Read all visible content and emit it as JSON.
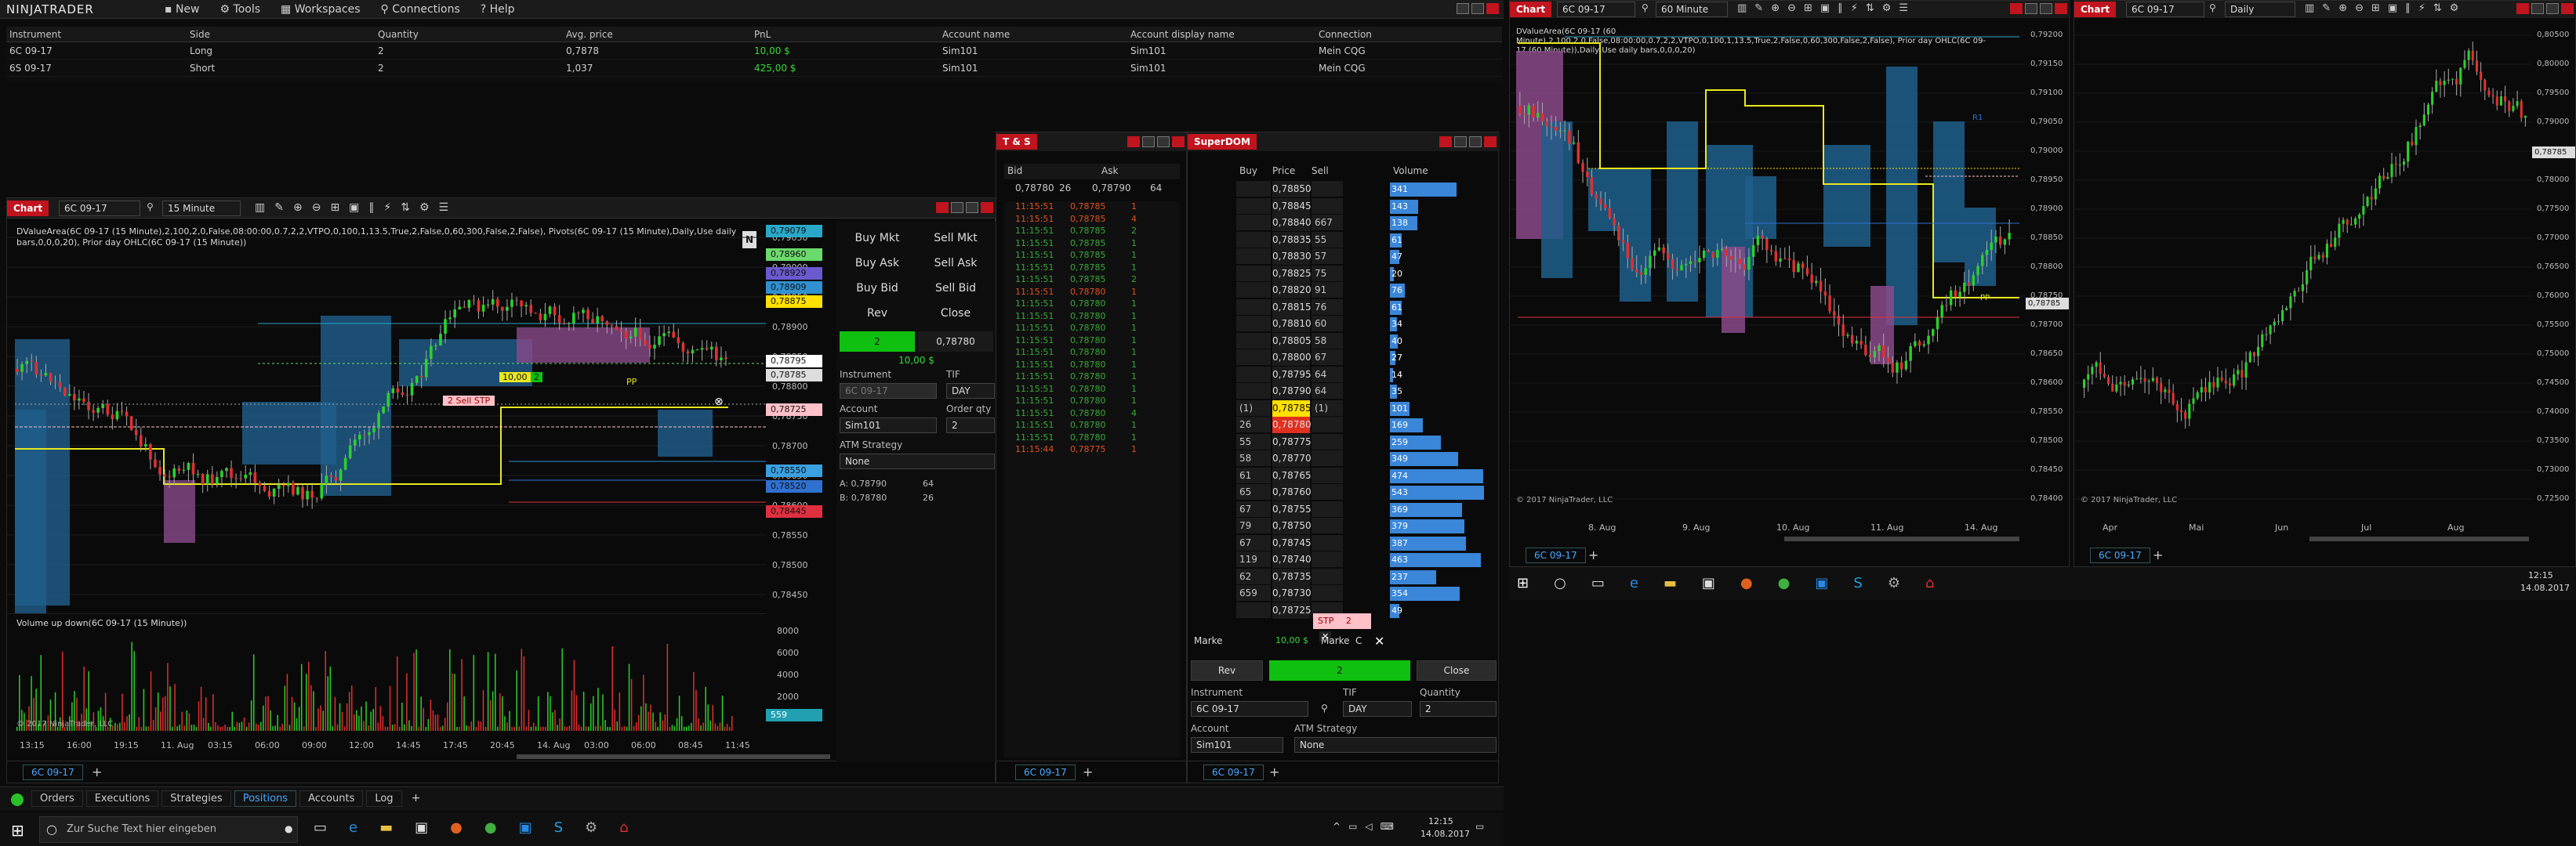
{
  "topbar": {
    "logo": "NINJATRADER",
    "menu": [
      "New",
      "Tools",
      "Workspaces",
      "Connections",
      "Help"
    ]
  },
  "positions": {
    "headers": [
      "Instrument",
      "Side",
      "Quantity",
      "Avg. price",
      "PnL",
      "Account name",
      "Account display name",
      "Connection"
    ],
    "rows": [
      [
        "6C 09-17",
        "Long",
        "2",
        "0,7878",
        "10,00 $",
        "Sim101",
        "Sim101",
        "Mein CQG"
      ],
      [
        "6S 09-17",
        "Short",
        "2",
        "1,037",
        "425,00 $",
        "Sim101",
        "Sim101",
        "Mein CQG"
      ]
    ]
  },
  "chart1": {
    "tab": "Chart",
    "instrument": "6C 09-17",
    "interval": "15 Minute",
    "info": "DValueArea(6C 09-17 (15 Minute),2,100,2,0,False,08:00:00,0.7,2,2,VTPO,0,100,1,13.5,True,2,False,0,60,300,False,2,False), Pivots(6C 09-17 (15 Minute),Daily,Use daily bars,0,0,0,20), Prior day OHLC(6C 09-17 (15 Minute))",
    "vol_label": "Volume up down(6C 09-17 (15 Minute))",
    "copyright": "© 2017 NinjaTrader, LLC",
    "price_ticks": [
      "0,79050",
      "0,79000",
      "0,78950",
      "0,78900",
      "0,78850",
      "0,78800",
      "0,78750",
      "0,78700",
      "0,78650",
      "0,78600",
      "0,78550",
      "0,78500",
      "0,78450"
    ],
    "price_flags": [
      {
        "t": "0,79079",
        "c": "#2aa8c8"
      },
      {
        "t": "0,78960",
        "c": "#6bd96b"
      },
      {
        "t": "0,78929",
        "c": "#6a5acd"
      },
      {
        "t": "0,78909",
        "c": "#3090d0"
      },
      {
        "t": "0,78875",
        "c": "#ffe000"
      },
      {
        "t": "0,78795",
        "c": "#ffffff"
      },
      {
        "t": "0,78785",
        "c": "#dddddd"
      },
      {
        "t": "0,78725",
        "c": "#ffc0c8"
      },
      {
        "t": "0,78550",
        "c": "#3aa0e0"
      },
      {
        "t": "0,78520",
        "c": "#3070d0"
      },
      {
        "t": "0,78445",
        "c": "#e03040"
      }
    ],
    "vol_ticks": [
      "8000",
      "6000",
      "4000",
      "2000"
    ],
    "vol_flag": "559",
    "time_ticks": [
      "13:15",
      "16:00",
      "19:15",
      "11. Aug",
      "03:15",
      "06:00",
      "09:00",
      "12:00",
      "14:45",
      "17:45",
      "20:45",
      "14. Aug",
      "03:00",
      "06:00",
      "08:45",
      "11:45"
    ],
    "pos_label": "10,00 $",
    "pos_qty": "2",
    "stop_label": "2 Sell STP",
    "pp_label": "PP",
    "bottom_tab": "6C 09-17"
  },
  "chart_trader": {
    "buttons": [
      "Buy Mkt",
      "Sell Mkt",
      "Buy Ask",
      "Sell Ask",
      "Buy Bid",
      "Sell Bid",
      "Rev",
      "Close"
    ],
    "qty": "2",
    "price": "0,78780",
    "pnl": "10,00 $",
    "instrument_label": "Instrument",
    "instrument": "6C 09-17",
    "tif_label": "TIF",
    "tif": "DAY",
    "account_label": "Account",
    "order_qty_label": "Order qty",
    "account": "Sim101",
    "order_qty": "2",
    "atm_label": "ATM Strategy",
    "atm": "None",
    "ask_line": "A:  0,78790",
    "ask_size": "64",
    "bid_line": "B:  0,78780",
    "bid_size": "26"
  },
  "ts": {
    "title": "T & S",
    "headers": [
      "Bid",
      "Ask"
    ],
    "bid": "0,78780",
    "bid_size": "26",
    "ask": "0,78790",
    "ask_size": "64",
    "rows": [
      [
        "11:15:51",
        "0,78785",
        "1",
        "r"
      ],
      [
        "11:15:51",
        "0,78785",
        "4",
        "r"
      ],
      [
        "11:15:51",
        "0,78785",
        "2",
        "g"
      ],
      [
        "11:15:51",
        "0,78785",
        "1",
        "g"
      ],
      [
        "11:15:51",
        "0,78785",
        "1",
        "g"
      ],
      [
        "11:15:51",
        "0,78785",
        "1",
        "g"
      ],
      [
        "11:15:51",
        "0,78785",
        "2",
        "g"
      ],
      [
        "11:15:51",
        "0,78780",
        "1",
        "r"
      ],
      [
        "11:15:51",
        "0,78780",
        "1",
        "g"
      ],
      [
        "11:15:51",
        "0,78780",
        "1",
        "g"
      ],
      [
        "11:15:51",
        "0,78780",
        "1",
        "g"
      ],
      [
        "11:15:51",
        "0,78780",
        "1",
        "g"
      ],
      [
        "11:15:51",
        "0,78780",
        "1",
        "g"
      ],
      [
        "11:15:51",
        "0,78780",
        "1",
        "g"
      ],
      [
        "11:15:51",
        "0,78780",
        "1",
        "g"
      ],
      [
        "11:15:51",
        "0,78780",
        "1",
        "g"
      ],
      [
        "11:15:51",
        "0,78780",
        "1",
        "g"
      ],
      [
        "11:15:51",
        "0,78780",
        "4",
        "g"
      ],
      [
        "11:15:51",
        "0,78780",
        "1",
        "g"
      ],
      [
        "11:15:51",
        "0,78780",
        "1",
        "g"
      ],
      [
        "11:15:44",
        "0,78775",
        "1",
        "r"
      ]
    ],
    "tab": "6C 09-17"
  },
  "dom": {
    "title": "SuperDOM",
    "headers": [
      "Buy",
      "Price",
      "Sell",
      "Volume"
    ],
    "rows": [
      [
        "",
        "0,78850",
        "",
        "341"
      ],
      [
        "",
        "0,78845",
        "",
        "143"
      ],
      [
        "",
        "0,78840",
        "667",
        "138"
      ],
      [
        "",
        "0,78835",
        "55",
        "61"
      ],
      [
        "",
        "0,78830",
        "57",
        "47"
      ],
      [
        "",
        "0,78825",
        "75",
        "20"
      ],
      [
        "",
        "0,78820",
        "91",
        "76"
      ],
      [
        "",
        "0,78815",
        "76",
        "61"
      ],
      [
        "",
        "0,78810",
        "60",
        "34"
      ],
      [
        "",
        "0,78805",
        "58",
        "40"
      ],
      [
        "",
        "0,78800",
        "67",
        "27"
      ],
      [
        "",
        "0,78795",
        "64",
        "14"
      ],
      [
        "",
        "0,78790",
        "64",
        "35"
      ],
      [
        "(1)",
        "0,78785",
        "(1)",
        "101"
      ],
      [
        "26",
        "0,78780",
        "",
        "169"
      ],
      [
        "55",
        "0,78775",
        "",
        "259"
      ],
      [
        "58",
        "0,78770",
        "",
        "349"
      ],
      [
        "61",
        "0,78765",
        "",
        "474"
      ],
      [
        "65",
        "0,78760",
        "",
        "543"
      ],
      [
        "67",
        "0,78755",
        "",
        "369"
      ],
      [
        "79",
        "0,78750",
        "",
        "379"
      ],
      [
        "67",
        "0,78745",
        "",
        "387"
      ],
      [
        "119",
        "0,78740",
        "",
        "463"
      ],
      [
        "62",
        "0,78735",
        "",
        "237"
      ],
      [
        "659",
        "0,78730",
        "",
        "354"
      ],
      [
        "",
        "0,78725",
        "",
        "49"
      ]
    ],
    "stp": "STP",
    "stp_qty": "2",
    "market_label": "Marke",
    "pnl": "10,00 $",
    "market_label2": "Marke",
    "c_label": "C",
    "rev": "Rev",
    "qty": "2",
    "close": "Close",
    "instrument_label": "Instrument",
    "instrument": "6C 09-17",
    "tif_label": "TIF",
    "tif": "DAY",
    "qty_label": "Quantity",
    "quantity": "2",
    "account_label": "Account",
    "account": "Sim101",
    "atm_label": "ATM Strategy",
    "atm": "None",
    "tab": "6C 09-17"
  },
  "chart2": {
    "tab": "Chart",
    "instrument": "6C 09-17",
    "interval": "60 Minute",
    "info": "DValueArea(6C 09-17 (60 Minute),2,100,2,0,False,08:00:00,0.7,2,2,VTPO,0,100,1,13.5,True,2,False,0,60,300,False,2,False), Prior day OHLC(6C 09-17 (60 Minute)),Daily,Use daily bars,0,0,0,20)",
    "price_ticks": [
      "0,79200",
      "0,79150",
      "0,79100",
      "0,79050",
      "0,79000",
      "0,78950",
      "0,78900",
      "0,78850",
      "0,78800",
      "0,78750",
      "0,78700",
      "0,78650",
      "0,78600",
      "0,78550",
      "0,78500",
      "0,78450",
      "0,78400"
    ],
    "flag": "0,78785",
    "time_ticks": [
      "8. Aug",
      "9. Aug",
      "10. Aug",
      "11. Aug",
      "14. Aug"
    ],
    "copyright": "© 2017 NinjaTrader, LLC",
    "pp": "PP",
    "r1": "R1",
    "bottom_tab": "6C 09-17"
  },
  "chart3": {
    "tab": "Chart",
    "instrument": "6C 09-17",
    "interval": "Daily",
    "price_ticks": [
      "0,80500",
      "0,80000",
      "0,79500",
      "0,79000",
      "0,78500",
      "0,78000",
      "0,77500",
      "0,77000",
      "0,76500",
      "0,76000",
      "0,75500",
      "0,75000",
      "0,74500",
      "0,74000",
      "0,73500",
      "0,73000",
      "0,72500"
    ],
    "flag": "0,78785",
    "time_ticks": [
      "Apr",
      "Mai",
      "Jun",
      "Jul",
      "Aug"
    ],
    "copyright": "© 2017 NinjaTrader, LLC",
    "bottom_tab": "6C 09-17"
  },
  "control_center": {
    "tabs": [
      "Orders",
      "Executions",
      "Strategies",
      "Positions",
      "Accounts",
      "Log"
    ],
    "active": "Positions"
  },
  "taskbar_left": {
    "search_placeholder": "Zur Suche Text hier eingeben",
    "time": "12:15",
    "date": "14.08.2017"
  },
  "taskbar_right": {
    "time": "12:15",
    "date": "14.08.2017"
  }
}
